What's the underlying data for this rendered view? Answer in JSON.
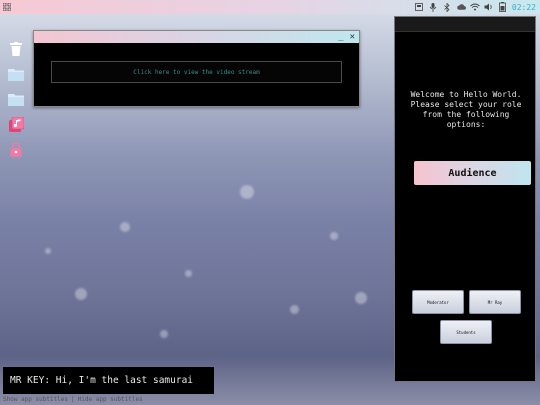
{
  "topbar": {
    "clock": "02:22",
    "status_icons": [
      "storage-icon",
      "microphone-icon",
      "bluetooth-icon",
      "cloud-icon",
      "wifi-icon",
      "volume-icon",
      "battery-icon"
    ]
  },
  "desktop": {
    "icons": [
      "trash-icon",
      "folder-icon",
      "folder-icon",
      "music-library-icon",
      "lock-icon"
    ]
  },
  "video_window": {
    "minimize_label": "_",
    "close_label": "✕",
    "stream_button": "Click here to view the video stream"
  },
  "panel": {
    "welcome": "Welcome to Hello World. Please select your role from the following options:",
    "audience_button": "Audience",
    "roles": {
      "moderator": "Moderator",
      "mr_ray": "Mr Ray",
      "students": "Students"
    }
  },
  "subtitles": {
    "text": "MR KEY: Hi, I'm the last samurai",
    "show_label": "Show app subtitles",
    "separator": "|",
    "hide_label": "Hide app subtitles"
  },
  "colors": {
    "accent_pink": "#f7c3cf",
    "accent_blue": "#bfe5ef",
    "clock": "#3aaec8",
    "icon_pink": "#e0457a"
  }
}
